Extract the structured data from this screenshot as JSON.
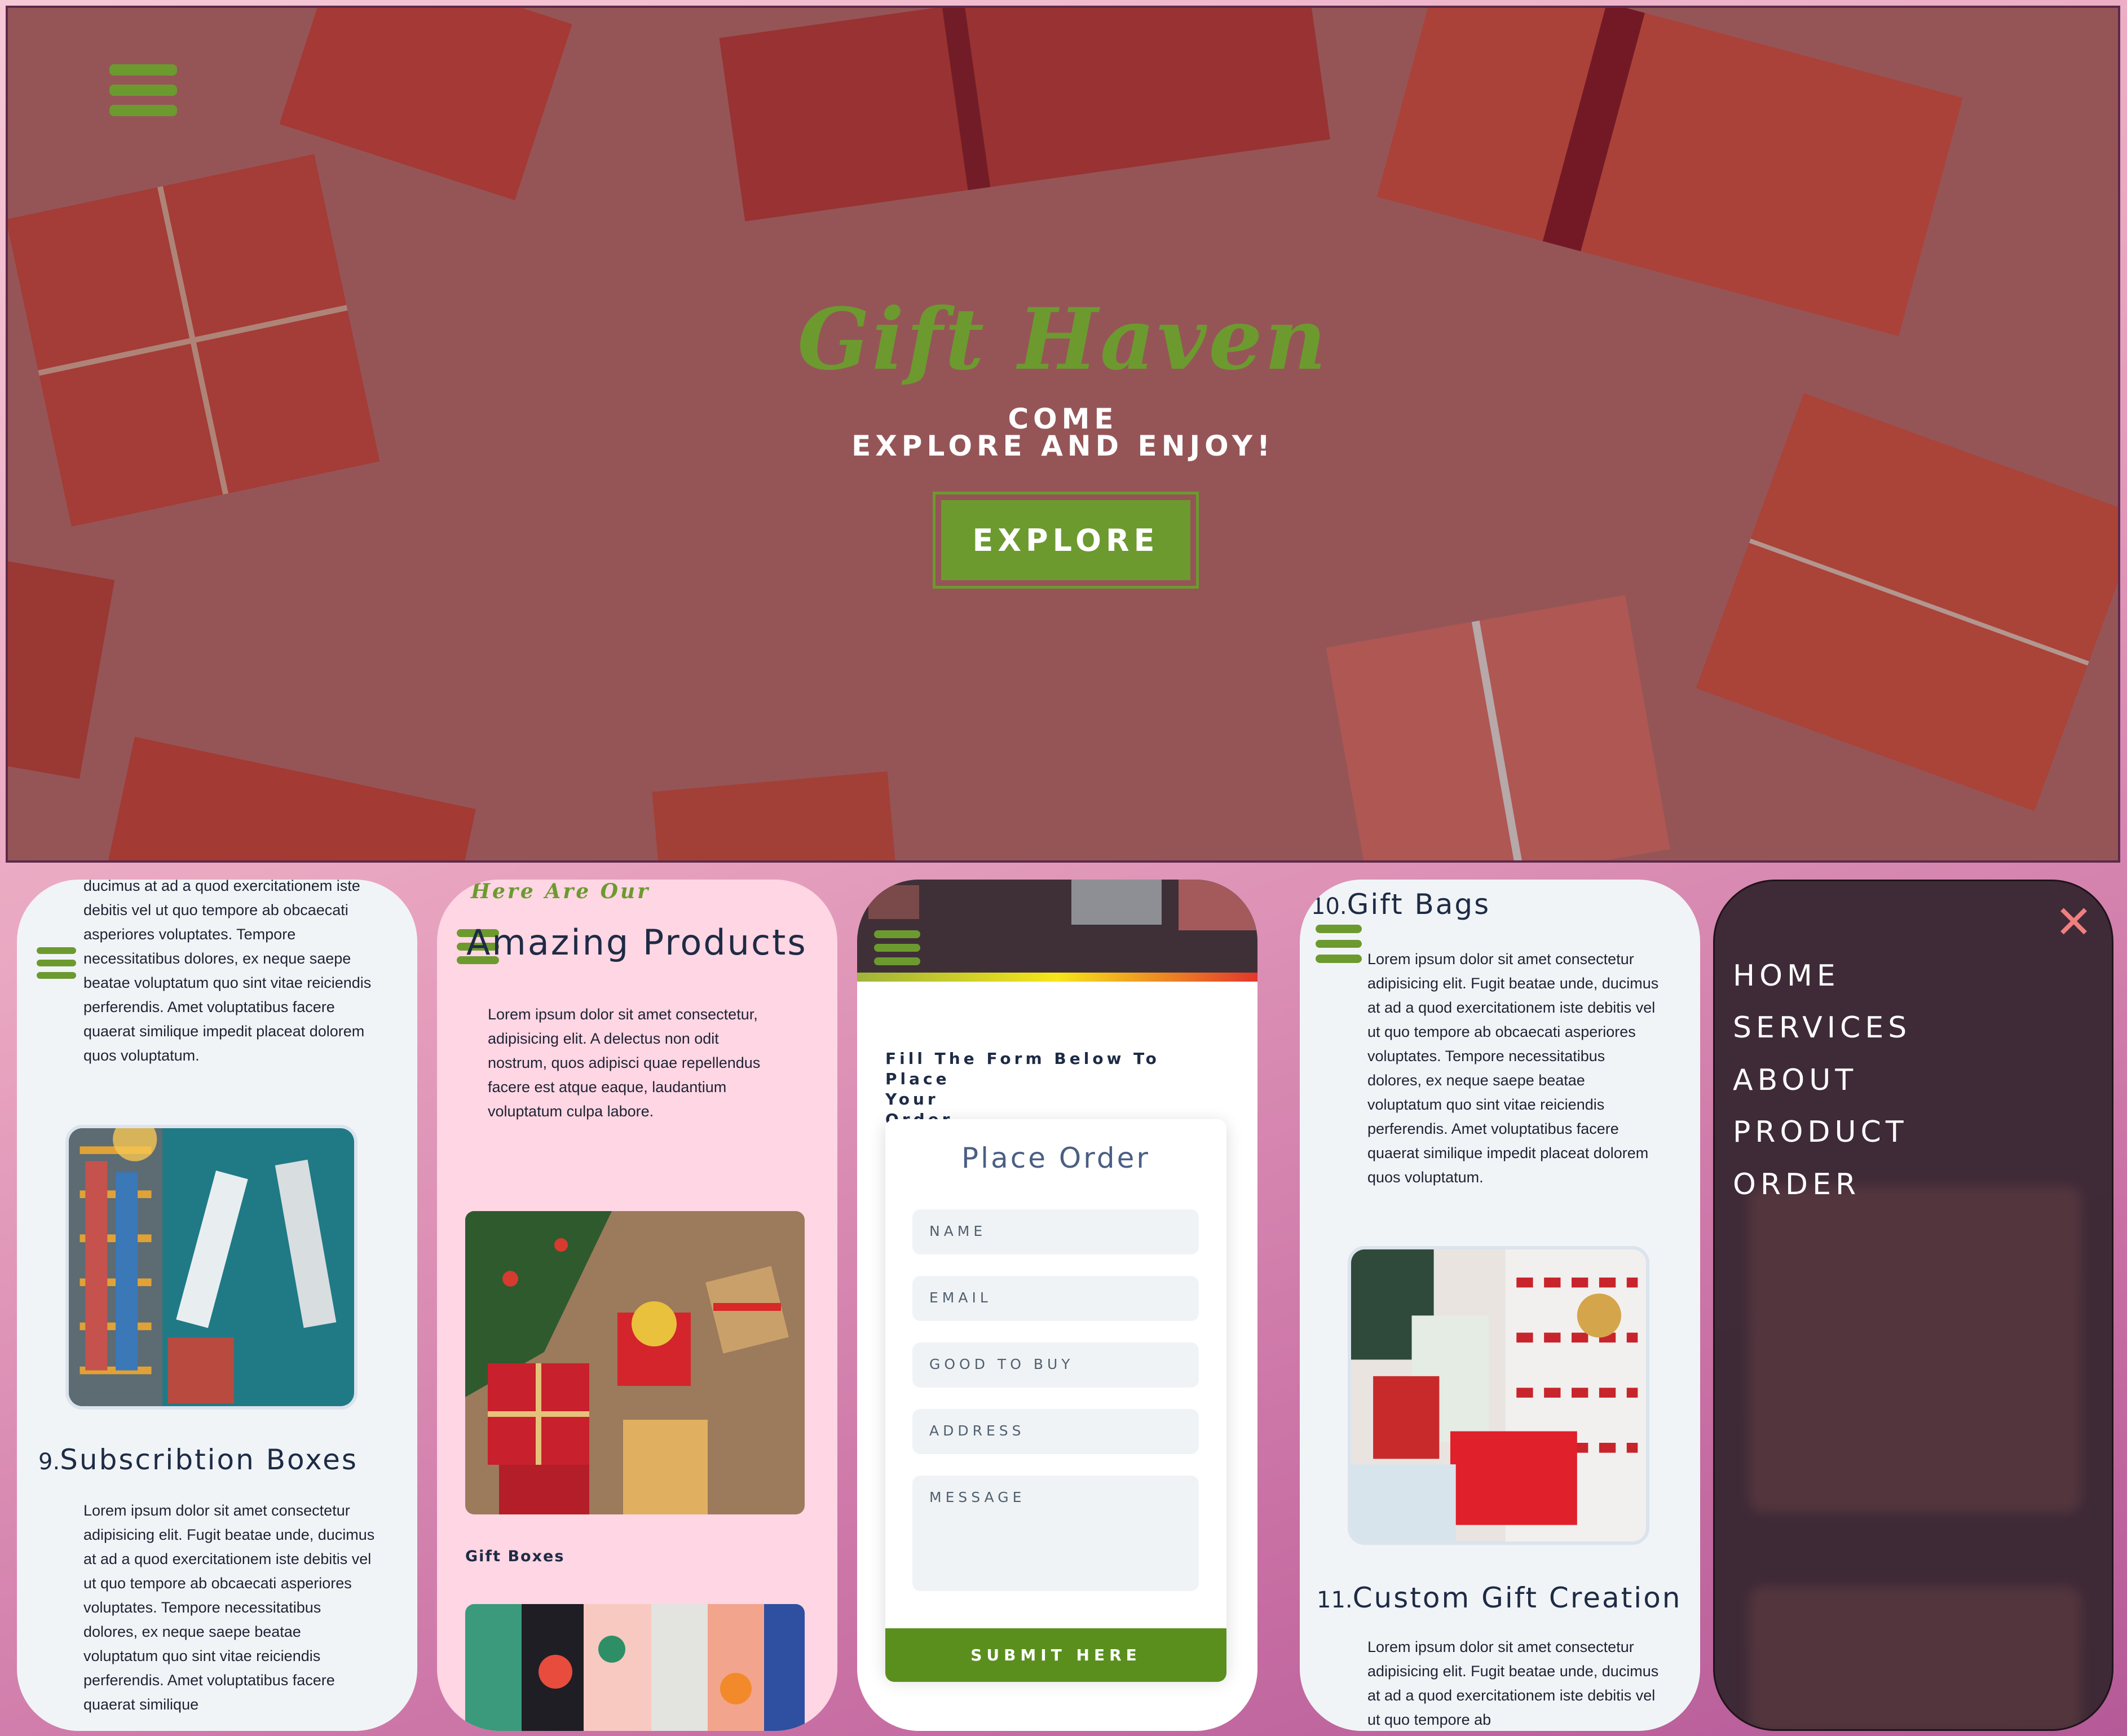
{
  "hero": {
    "brand": "Gift Haven",
    "tagline_line1": "COME",
    "tagline_line2": "EXPLORE AND ENJOY!",
    "cta_label": "EXPLORE"
  },
  "phone1": {
    "top_paragraph": "ducimus at ad a quod exercitationem iste debitis vel ut quo tempore ab obcaecati asperiores voluptates. Tempore necessitatibus dolores, ex neque saepe beatae voluptatum quo sint vitae reiciendis perferendis. Amet voluptatibus facere quaerat similique impedit placeat dolorem quos voluptatum.",
    "section_number": "9.",
    "section_title": "Subscribtion Boxes",
    "section_paragraph": "Lorem ipsum dolor sit amet consectetur adipisicing elit. Fugit beatae unde, ducimus at ad a quod exercitationem iste debitis vel ut quo tempore ab obcaecati asperiores voluptates. Tempore necessitatibus dolores, ex neque saepe beatae voluptatum quo sint vitae reiciendis perferendis. Amet voluptatibus facere quaerat similique"
  },
  "phone2": {
    "eyebrow": "Here Are Our",
    "title": "Amazing Products",
    "intro": "Lorem ipsum dolor sit amet consectetur, adipisicing elit. A delectus non odit nostrum, quos adipisci quae repellendus facere est atque eaque, laudantium voluptatum culpa labore.",
    "product_label": "Gift Boxes"
  },
  "phone3": {
    "intro_line1": "Fill The Form Below To Place",
    "intro_line2": "Your",
    "intro_line3": "Order",
    "form_title": "Place Order",
    "fields": [
      "NAME",
      "EMAIL",
      "GOOD TO BUY",
      "ADDRESS",
      "MESSAGE"
    ],
    "submit_label": "SUBMIT HERE"
  },
  "phone4": {
    "top_number": "10.",
    "top_title": "Gift Bags",
    "top_paragraph": "Lorem ipsum dolor sit amet consectetur adipisicing elit. Fugit beatae unde, ducimus at ad a quod exercitationem iste debitis vel ut quo tempore ab obcaecati asperiores voluptates. Tempore necessitatibus dolores, ex neque saepe beatae voluptatum quo sint vitae reiciendis perferendis. Amet voluptatibus facere quaerat similique impedit placeat dolorem quos voluptatum.",
    "section_number": "11.",
    "section_title": "Custom Gift Creation",
    "section_paragraph": "Lorem ipsum dolor sit amet consectetur adipisicing elit. Fugit beatae unde, ducimus at ad a quod exercitationem iste debitis vel ut quo tempore ab"
  },
  "phone5": {
    "close_icon": "close-icon",
    "menu": [
      "HOME",
      "SERVICES",
      "ABOUT",
      "PRODUCT",
      "ORDER"
    ]
  },
  "colors": {
    "accent_green": "#6c9a2f",
    "submit_green": "#5a8f1e",
    "close_pink": "#f07f7f"
  }
}
